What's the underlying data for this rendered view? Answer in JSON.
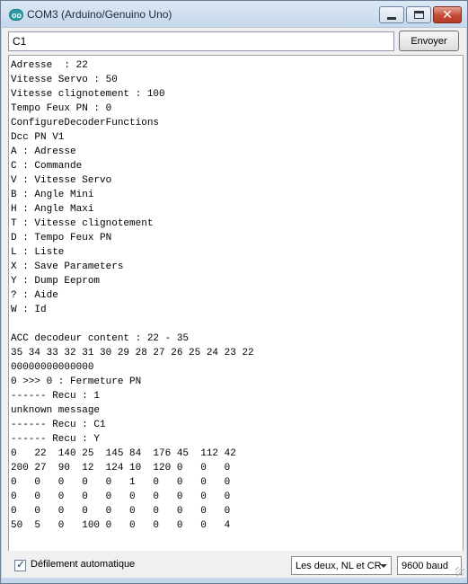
{
  "window": {
    "title": "COM3 (Arduino/Genuino Uno)",
    "icon_text": "oo",
    "accent": "#2a9aa3",
    "close_glyph": "✕"
  },
  "toolbar": {
    "input_value": "C1",
    "send_label": "Envoyer"
  },
  "output": {
    "lines": [
      "Adresse  : 22",
      "Vitesse Servo : 50",
      "Vitesse clignotement : 100",
      "Tempo Feux PN : 0",
      "ConfigureDecoderFunctions",
      "Dcc PN V1",
      "A : Adresse",
      "C : Commande",
      "V : Vitesse Servo",
      "B : Angle Mini",
      "H : Angle Maxi",
      "T : Vitesse clignotement",
      "D : Tempo Feux PN",
      "L : Liste",
      "X : Save Parameters",
      "Y : Dump Eeprom",
      "? : Aide",
      "W : Id",
      "",
      "ACC decodeur content : 22 - 35",
      "35 34 33 32 31 30 29 28 27 26 25 24 23 22",
      "00000000000000",
      "0 >>> 0 : Fermeture PN",
      "------ Recu : 1",
      "unknown message",
      "------ Recu : C1",
      "------ Recu : Y",
      "0   22  140 25  145 84  176 45  112 42",
      "200 27  90  12  124 10  120 0   0   0",
      "0   0   0   0   0   1   0   0   0   0",
      "0   0   0   0   0   0   0   0   0   0",
      "0   0   0   0   0   0   0   0   0   0",
      "50  5   0   100 0   0   0   0   0   4"
    ]
  },
  "statusbar": {
    "autoscroll_label": "Défilement automatique",
    "autoscroll_checked": true,
    "checkmark": "✓",
    "line_ending": "Les deux, NL et CR",
    "baud": "9600 baud"
  }
}
